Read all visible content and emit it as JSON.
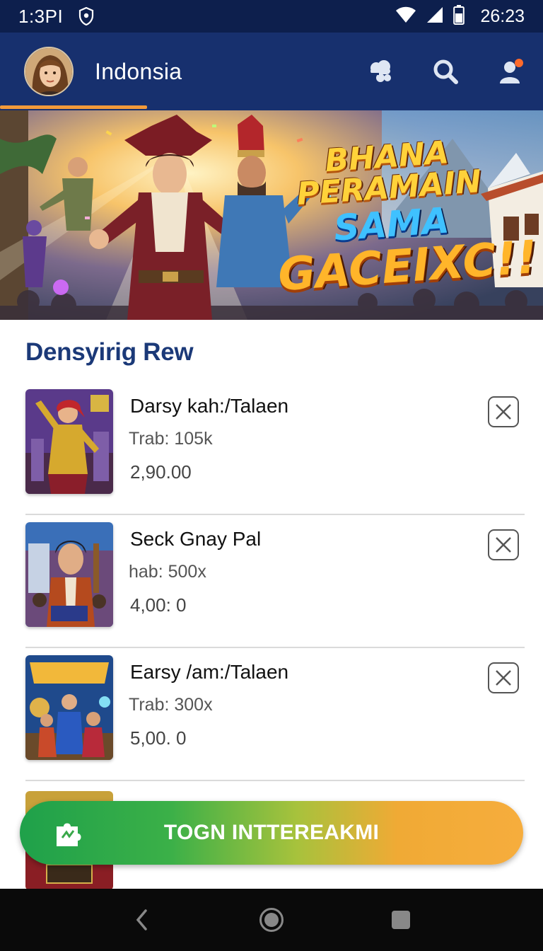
{
  "status_bar": {
    "time": "1:3PI",
    "clock": "26:23",
    "icons": [
      "shield-icon",
      "wifi-icon",
      "signal-icon",
      "battery-icon"
    ]
  },
  "app_bar": {
    "title": "Indonsia",
    "avatar": "user-avatar",
    "actions": [
      "cloud-icon",
      "search-icon",
      "profile-icon"
    ],
    "accent_color": "#f29a3a"
  },
  "banner": {
    "line1": "BHANA",
    "line2": "PERAMAIN",
    "line3": "SAMA",
    "line4": "GACEIXC!!"
  },
  "section": {
    "title": "Densyirig Rew"
  },
  "items": [
    {
      "title": "Darsy kah:/Talaen",
      "meta": "Trab: 105k",
      "price": "2,90.00"
    },
    {
      "title": "Seck Gnay Pal",
      "meta": "hab: 500x",
      "price": "4,00: 0"
    },
    {
      "title": "Earsy /am:/Talaen",
      "meta": "Trab: 300x",
      "price": "5,00. 0"
    }
  ],
  "cta": {
    "label": "TOGN INTTEREAKMI",
    "gradient_start": "#1fa14a",
    "gradient_end": "#f6ad3d"
  },
  "nav": [
    "back-icon",
    "home-icon",
    "recents-icon"
  ]
}
